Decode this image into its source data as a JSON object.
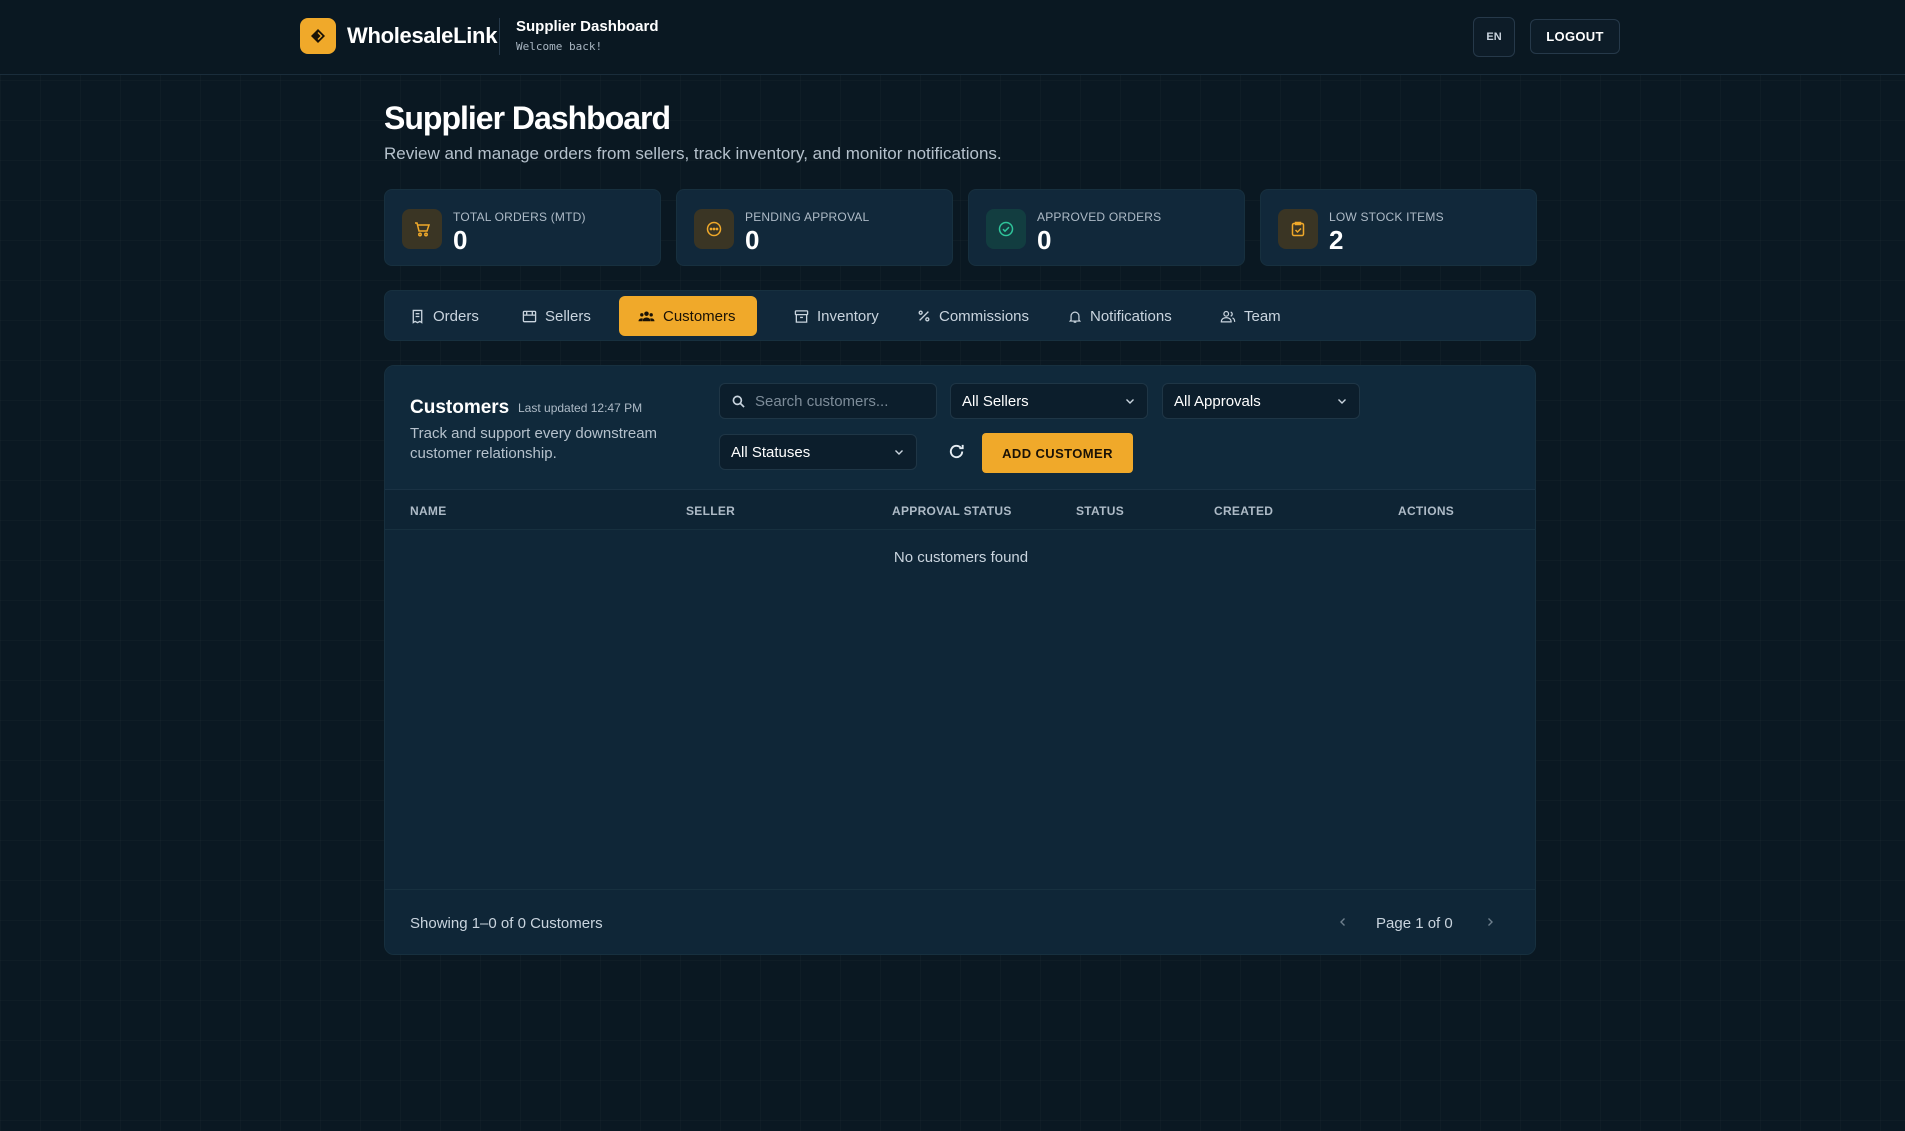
{
  "header": {
    "brand": "WholesaleLink",
    "section_title": "Supplier Dashboard",
    "welcome": "Welcome back!",
    "lang": "EN",
    "logout": "LOGOUT"
  },
  "page": {
    "title": "Supplier Dashboard",
    "description": "Review and manage orders from sellers, track inventory, and monitor notifications."
  },
  "stats": [
    {
      "label": "TOTAL ORDERS (MTD)",
      "value": "0",
      "icon": "cart-icon",
      "color": "#f0a92a"
    },
    {
      "label": "PENDING APPROVAL",
      "value": "0",
      "icon": "pending-icon",
      "color": "#f0a92a"
    },
    {
      "label": "APPROVED ORDERS",
      "value": "0",
      "icon": "check-circle-icon",
      "color": "#2fc49a"
    },
    {
      "label": "LOW STOCK ITEMS",
      "value": "2",
      "icon": "clipboard-check-icon",
      "color": "#f0a92a"
    }
  ],
  "tabs": [
    {
      "label": "Orders",
      "icon": "receipt-icon",
      "active": false
    },
    {
      "label": "Sellers",
      "icon": "store-icon",
      "active": false
    },
    {
      "label": "Customers",
      "icon": "users-icon",
      "active": true
    },
    {
      "label": "Inventory",
      "icon": "archive-icon",
      "active": false
    },
    {
      "label": "Commissions",
      "icon": "percent-icon",
      "active": false
    },
    {
      "label": "Notifications",
      "icon": "bell-icon",
      "active": false
    },
    {
      "label": "Team",
      "icon": "team-icon",
      "active": false
    }
  ],
  "customers": {
    "title": "Customers",
    "last_updated": "Last updated 12:47 PM",
    "description": "Track and support every downstream customer relationship.",
    "search_placeholder": "Search customers...",
    "filters": {
      "sellers": "All Sellers",
      "approvals": "All Approvals",
      "statuses": "All Statuses"
    },
    "add_button": "ADD CUSTOMER",
    "columns": [
      "NAME",
      "SELLER",
      "APPROVAL STATUS",
      "STATUS",
      "CREATED",
      "ACTIONS"
    ],
    "empty": "No customers found",
    "showing": "Showing 1–0 of 0 Customers",
    "page": "Page 1 of 0"
  },
  "colors": {
    "accent": "#f0a92a",
    "background": "#0a1822",
    "card": "#11283a",
    "success": "#2fc49a"
  }
}
